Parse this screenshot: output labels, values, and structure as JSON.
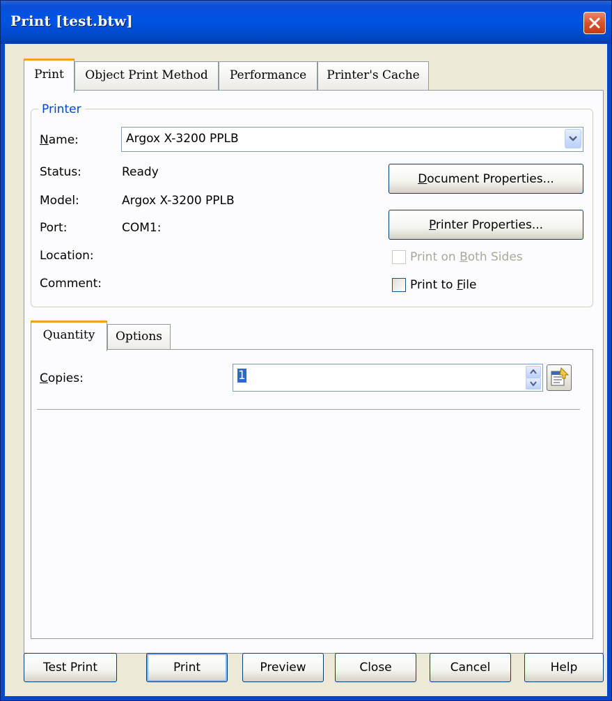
{
  "window": {
    "title": "Print [test.btw]"
  },
  "tabs": [
    {
      "label": "Print"
    },
    {
      "label": "Object Print Method"
    },
    {
      "label": "Performance"
    },
    {
      "label": "Printer's Cache"
    }
  ],
  "printer": {
    "group_label": "Printer",
    "name_label_u": "N",
    "name_label_rest": "ame:",
    "name_value": "Argox X-3200 PPLB",
    "status_label": "Status:",
    "status_value": "Ready",
    "model_label": "Model:",
    "model_value": "Argox X-3200 PPLB",
    "port_label": "Port:",
    "port_value": "COM1:",
    "location_label": "Location:",
    "location_value": "",
    "comment_label": "Comment:",
    "comment_value": "",
    "doc_props_u": "D",
    "doc_props_rest": "ocument Properties...",
    "printer_props_u": "P",
    "printer_props_rest": "rinter Properties...",
    "both_sides_a": "Print on ",
    "both_sides_u": "B",
    "both_sides_b": "oth Sides",
    "print_to_file_a": "Print to ",
    "print_to_file_u": "F",
    "print_to_file_b": "ile"
  },
  "subtabs": [
    {
      "label": "Quantity"
    },
    {
      "label": "Options"
    }
  ],
  "quantity": {
    "copies_label_u": "C",
    "copies_label_rest": "opies:",
    "copies_value": "1"
  },
  "footer": {
    "test_print": "Test Print",
    "print": "Print",
    "preview": "Preview",
    "close": "Close",
    "cancel": "Cancel",
    "help": "Help"
  },
  "colors": {
    "titlebar": "#0054E3",
    "accent_tab": "#F3A11A",
    "group_label": "#0046D5",
    "selection": "#316AC5",
    "face": "#ECE9D8"
  }
}
